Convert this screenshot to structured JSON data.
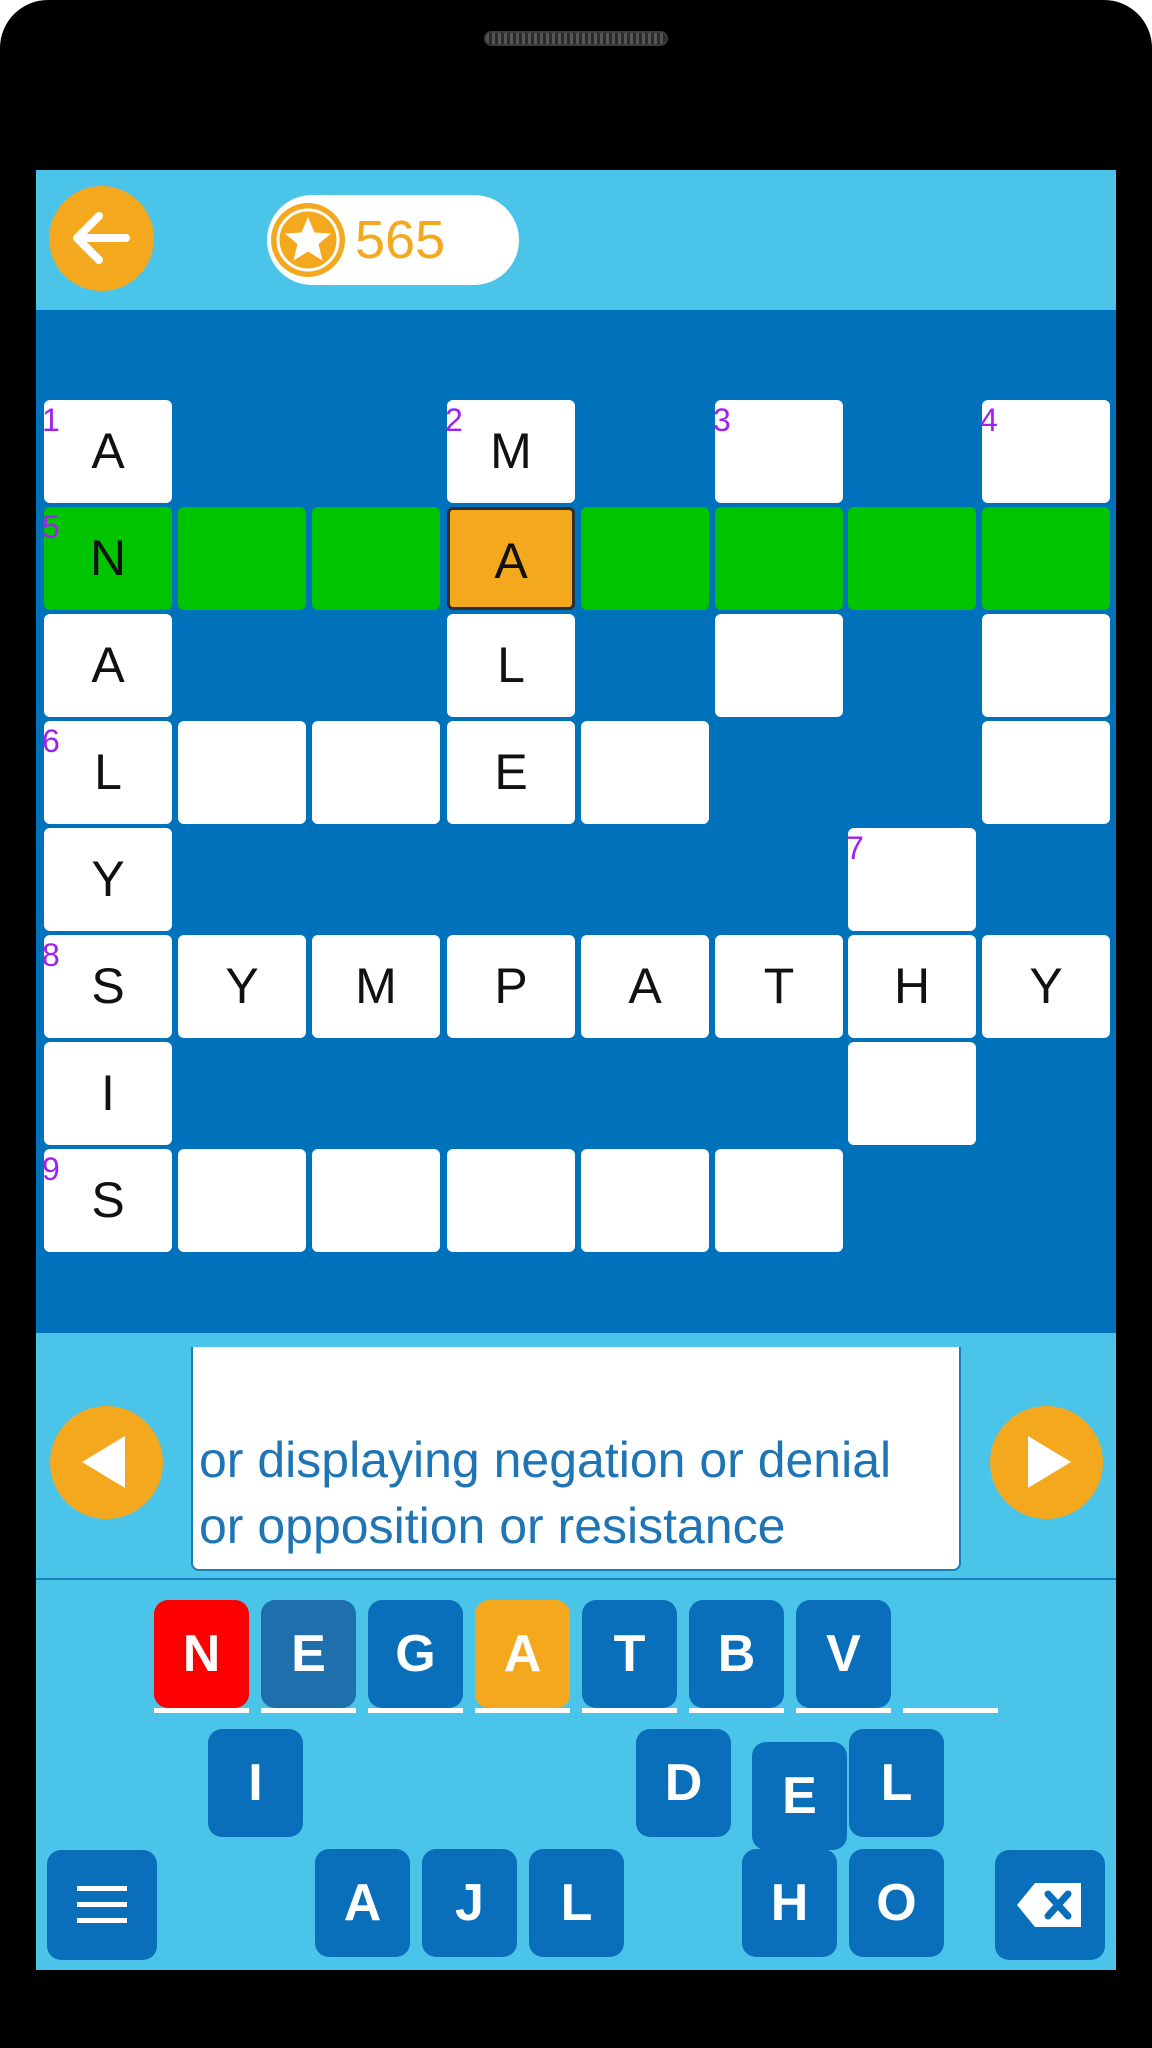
{
  "header": {
    "back_icon": "arrow-left-icon",
    "coin_icon": "star-coin-icon",
    "coins": "565"
  },
  "colors": {
    "sky": "#4bc4e9",
    "board": "#0072bb",
    "highlight": "#00c400",
    "current": "#f3a81e",
    "clue_number": "#a020f0",
    "wrong_tile": "#ff0000"
  },
  "grid": {
    "cells": [
      {
        "name": "cell-1",
        "num": "1",
        "letter": "A",
        "state": "normal"
      },
      {
        "name": "cell-2",
        "num": "2",
        "letter": "M",
        "state": "normal"
      },
      {
        "name": "cell-3",
        "num": "3",
        "letter": "",
        "state": "normal"
      },
      {
        "name": "cell-4",
        "num": "4",
        "letter": "",
        "state": "normal"
      },
      {
        "name": "cell-5",
        "num": "5",
        "letter": "N",
        "state": "highlight"
      },
      {
        "name": "cell-6",
        "num": "",
        "letter": "",
        "state": "highlight"
      },
      {
        "name": "cell-7",
        "num": "",
        "letter": "",
        "state": "highlight"
      },
      {
        "name": "cell-8",
        "num": "",
        "letter": "A",
        "state": "current"
      },
      {
        "name": "cell-9",
        "num": "",
        "letter": "",
        "state": "highlight"
      },
      {
        "name": "cell-10",
        "num": "",
        "letter": "",
        "state": "highlight"
      },
      {
        "name": "cell-11",
        "num": "",
        "letter": "",
        "state": "highlight"
      },
      {
        "name": "cell-12",
        "num": "",
        "letter": "",
        "state": "highlight"
      },
      {
        "name": "cell-13",
        "num": "",
        "letter": "A",
        "state": "normal"
      },
      {
        "name": "cell-14",
        "num": "",
        "letter": "L",
        "state": "normal"
      },
      {
        "name": "cell-15",
        "num": "",
        "letter": "",
        "state": "normal"
      },
      {
        "name": "cell-16",
        "num": "",
        "letter": "",
        "state": "normal"
      },
      {
        "name": "cell-17",
        "num": "6",
        "letter": "L",
        "state": "normal"
      },
      {
        "name": "cell-18",
        "num": "",
        "letter": "",
        "state": "normal"
      },
      {
        "name": "cell-19",
        "num": "",
        "letter": "",
        "state": "normal"
      },
      {
        "name": "cell-20",
        "num": "",
        "letter": "E",
        "state": "normal"
      },
      {
        "name": "cell-21",
        "num": "",
        "letter": "",
        "state": "normal"
      },
      {
        "name": "cell-22",
        "num": "",
        "letter": "",
        "state": "normal"
      },
      {
        "name": "cell-23",
        "num": "",
        "letter": "Y",
        "state": "normal"
      },
      {
        "name": "cell-24",
        "num": "7",
        "letter": "",
        "state": "normal"
      },
      {
        "name": "cell-25",
        "num": "8",
        "letter": "S",
        "state": "normal"
      },
      {
        "name": "cell-26",
        "num": "",
        "letter": "Y",
        "state": "normal"
      },
      {
        "name": "cell-27",
        "num": "",
        "letter": "M",
        "state": "normal"
      },
      {
        "name": "cell-28",
        "num": "",
        "letter": "P",
        "state": "normal"
      },
      {
        "name": "cell-29",
        "num": "",
        "letter": "A",
        "state": "normal"
      },
      {
        "name": "cell-30",
        "num": "",
        "letter": "T",
        "state": "normal"
      },
      {
        "name": "cell-31",
        "num": "",
        "letter": "H",
        "state": "normal"
      },
      {
        "name": "cell-32",
        "num": "",
        "letter": "Y",
        "state": "normal"
      },
      {
        "name": "cell-33",
        "num": "",
        "letter": "I",
        "state": "normal"
      },
      {
        "name": "cell-34",
        "num": "",
        "letter": "",
        "state": "normal"
      },
      {
        "name": "cell-35",
        "num": "9",
        "letter": "S",
        "state": "normal"
      },
      {
        "name": "cell-36",
        "num": "",
        "letter": "",
        "state": "normal"
      },
      {
        "name": "cell-37",
        "num": "",
        "letter": "",
        "state": "normal"
      },
      {
        "name": "cell-38",
        "num": "",
        "letter": "",
        "state": "normal"
      },
      {
        "name": "cell-39",
        "num": "",
        "letter": "",
        "state": "normal"
      },
      {
        "name": "cell-40",
        "num": "",
        "letter": "",
        "state": "normal"
      }
    ]
  },
  "clue": {
    "text": "or displaying negation or denial or opposition or resistance",
    "prev_icon": "triangle-left-icon",
    "next_icon": "triangle-right-icon"
  },
  "answer_tiles": [
    {
      "letter": "N",
      "state": "wrong"
    },
    {
      "letter": "E",
      "state": "filled"
    },
    {
      "letter": "G",
      "state": "filled"
    },
    {
      "letter": "A",
      "state": "current"
    },
    {
      "letter": "T",
      "state": "filled"
    },
    {
      "letter": "B",
      "state": "filled"
    },
    {
      "letter": "V",
      "state": "filled"
    },
    {
      "letter": "",
      "state": "empty"
    }
  ],
  "letter_pool": [
    "I",
    "D",
    "E",
    "L",
    "A",
    "J",
    "L",
    "H",
    "O"
  ],
  "controls": {
    "menu_icon": "hamburger-menu-icon",
    "delete_icon": "backspace-icon"
  }
}
